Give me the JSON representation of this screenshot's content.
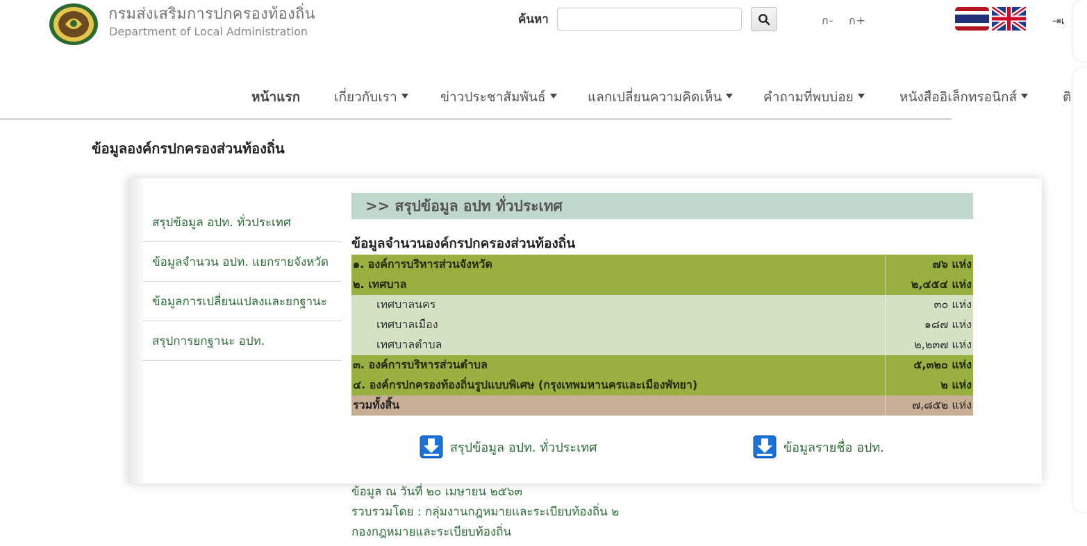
{
  "header": {
    "org_name_th": "กรมส่งเสริมการปกครองท้องถิ่น",
    "org_name_en": "Department of Local Administration",
    "search_label": "ค้นหา",
    "search_placeholder": "",
    "font_decrease": "ก-",
    "font_increase": "ก+",
    "login_label": "เ"
  },
  "nav": {
    "items": [
      {
        "label": "หน้าแรก",
        "has_dropdown": false
      },
      {
        "label": "เกี่ยวกับเรา",
        "has_dropdown": true
      },
      {
        "label": "ข่าวประชาสัมพันธ์",
        "has_dropdown": true
      },
      {
        "label": "แลกเปลี่ยนความคิดเห็น",
        "has_dropdown": true
      },
      {
        "label": "คำถามที่พบบ่อย",
        "has_dropdown": true
      },
      {
        "label": "หนังสืออิเล็กทรอนิกส์",
        "has_dropdown": true
      },
      {
        "label": "ติ",
        "has_dropdown": false
      }
    ]
  },
  "page": {
    "title": "ข้อมูลองค์กรปกครองส่วนท้องถิ่น"
  },
  "sidemenu": {
    "items": [
      "สรุปข้อมูล อปท. ทั่วประเทศ",
      "ข้อมูลจำนวน อปท. แยกรายจังหวัด",
      "ข้อมูลการเปลี่ยนแปลงและยกฐานะ",
      "สรุปการยกฐานะ อปท."
    ]
  },
  "content": {
    "section_heading": ">> สรุปข้อมูล อปท ทั่วประเทศ",
    "table_title": "ข้อมูลจำนวนองค์กรปกครองส่วนท้องถิ่น",
    "rows": [
      {
        "label": "๑. องค์การบริหารส่วนจังหวัด",
        "value": "๗๖ แห่ง",
        "kind": "main"
      },
      {
        "label": "๒. เทศบาล",
        "value": "๒,๔๕๔ แห่ง",
        "kind": "main"
      },
      {
        "label": "เทศบาลนคร",
        "value": "๓๐ แห่ง",
        "kind": "sub"
      },
      {
        "label": "เทศบาลเมือง",
        "value": "๑๘๗ แห่ง",
        "kind": "sub"
      },
      {
        "label": "เทศบาลตำบล",
        "value": "๒,๒๓๗ แห่ง",
        "kind": "sub"
      },
      {
        "label": "๓. องค์การบริหารส่วนตำบล",
        "value": "๕,๓๒๐ แห่ง",
        "kind": "main"
      },
      {
        "label": "๔. องค์กรปกครองท้องถิ่นรูปแบบพิเศษ (กรุงเทพมหานครและเมืองพัทยา)",
        "value": "๒ แห่ง",
        "kind": "main"
      },
      {
        "label": "รวมทั้งสิ้น",
        "value": "๗,๘๕๒ แห่ง",
        "kind": "total"
      }
    ],
    "downloads": [
      {
        "label": "สรุปข้อมูล อปท. ทั่วประเทศ",
        "icon": "download-icon"
      },
      {
        "label": "ข้อมูลรายชื่อ อปท.",
        "icon": "download-icon"
      }
    ],
    "footer_lines": [
      "ข้อมูล ณ วันที่ ๒๐ เมษายน ๒๕๖๓",
      "รวบรวมโดย : กลุ่มงานกฎหมายและระเบียบท้องถิ่น ๒",
      "กองกฎหมายและระเบียบท้องถิ่น"
    ]
  },
  "colors": {
    "accent_green": "#2f6b38",
    "row_main": "#97b040",
    "row_sub": "#d4e2c4",
    "row_total": "#c8ae94",
    "section_head": "#c0d8cb"
  }
}
